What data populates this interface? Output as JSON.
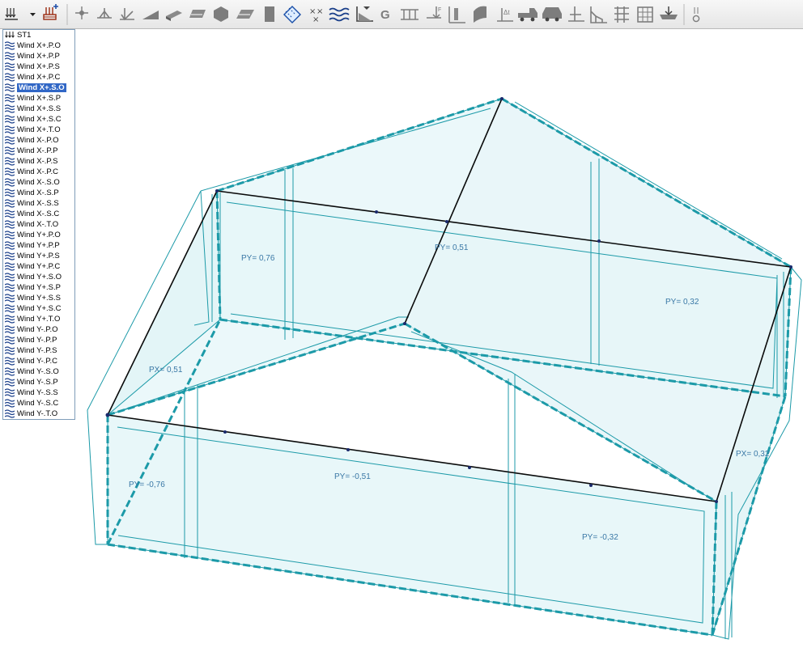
{
  "app": {
    "colors": {
      "panel_fill": "#e8f7f9",
      "edge": "#1c9aa8",
      "member": "#0a0a0a",
      "label": "#3a78a6",
      "selection": "#3167c6"
    }
  },
  "toolbar": {
    "buttons": [
      {
        "name": "load-cases-icon",
        "interactable": true
      },
      {
        "name": "dropdown-arrow-icon",
        "interactable": true
      },
      {
        "name": "add-load-case-icon",
        "interactable": true
      },
      {
        "name": "nodal-load-icon",
        "interactable": true
      },
      {
        "name": "member-load-icon",
        "interactable": true
      },
      {
        "name": "support-load-icon",
        "interactable": true
      },
      {
        "name": "linear-load-icon",
        "interactable": true
      },
      {
        "name": "surface-load-icon",
        "interactable": true
      },
      {
        "name": "panel-load-icon",
        "interactable": true
      },
      {
        "name": "solid-load-icon",
        "interactable": true
      },
      {
        "name": "planar-load-icon",
        "interactable": true
      },
      {
        "name": "block-load-icon",
        "interactable": true
      },
      {
        "name": "wind-load-icon",
        "interactable": true
      },
      {
        "name": "snow-load-icon",
        "interactable": true
      },
      {
        "name": "wave-load-icon",
        "interactable": true
      },
      {
        "name": "hydrostatic-load-icon",
        "interactable": true
      },
      {
        "name": "self-weight-icon",
        "interactable": true
      },
      {
        "name": "trapezoid-load-icon",
        "interactable": true
      },
      {
        "name": "point-force-icon",
        "interactable": true
      },
      {
        "name": "thermal-load-icon",
        "interactable": true
      },
      {
        "name": "body-force-icon",
        "interactable": true
      },
      {
        "name": "temperature-load-icon",
        "interactable": true
      },
      {
        "name": "moving-load-icon",
        "interactable": true
      },
      {
        "name": "vehicle-load-icon",
        "interactable": true
      },
      {
        "name": "displacement-load-icon",
        "interactable": true
      },
      {
        "name": "frame-load-icon",
        "interactable": true
      },
      {
        "name": "mesh-load-icon",
        "interactable": true
      },
      {
        "name": "grid-load-icon",
        "interactable": true
      },
      {
        "name": "roof-load-icon",
        "interactable": true
      },
      {
        "name": "load-parameters-icon",
        "interactable": true
      }
    ],
    "self_weight_glyph": "G"
  },
  "loadcase_list": {
    "items": [
      {
        "label": "ST1",
        "selected": false,
        "icon": "static-load-icon"
      },
      {
        "label": "Wind X+.P.O",
        "selected": false,
        "icon": "wind-load-icon"
      },
      {
        "label": "Wind X+.P.P",
        "selected": false,
        "icon": "wind-load-icon"
      },
      {
        "label": "Wind X+.P.S",
        "selected": false,
        "icon": "wind-load-icon"
      },
      {
        "label": "Wind X+.P.C",
        "selected": false,
        "icon": "wind-load-icon"
      },
      {
        "label": "Wind X+.S.O",
        "selected": true,
        "icon": "wind-load-icon"
      },
      {
        "label": "Wind X+.S.P",
        "selected": false,
        "icon": "wind-load-icon"
      },
      {
        "label": "Wind X+.S.S",
        "selected": false,
        "icon": "wind-load-icon"
      },
      {
        "label": "Wind X+.S.C",
        "selected": false,
        "icon": "wind-load-icon"
      },
      {
        "label": "Wind X+.T.O",
        "selected": false,
        "icon": "wind-load-icon"
      },
      {
        "label": "Wind X-.P.O",
        "selected": false,
        "icon": "wind-load-icon"
      },
      {
        "label": "Wind X-.P.P",
        "selected": false,
        "icon": "wind-load-icon"
      },
      {
        "label": "Wind X-.P.S",
        "selected": false,
        "icon": "wind-load-icon"
      },
      {
        "label": "Wind X-.P.C",
        "selected": false,
        "icon": "wind-load-icon"
      },
      {
        "label": "Wind X-.S.O",
        "selected": false,
        "icon": "wind-load-icon"
      },
      {
        "label": "Wind X-.S.P",
        "selected": false,
        "icon": "wind-load-icon"
      },
      {
        "label": "Wind X-.S.S",
        "selected": false,
        "icon": "wind-load-icon"
      },
      {
        "label": "Wind X-.S.C",
        "selected": false,
        "icon": "wind-load-icon"
      },
      {
        "label": "Wind X-.T.O",
        "selected": false,
        "icon": "wind-load-icon"
      },
      {
        "label": "Wind Y+.P.O",
        "selected": false,
        "icon": "wind-load-icon"
      },
      {
        "label": "Wind Y+.P.P",
        "selected": false,
        "icon": "wind-load-icon"
      },
      {
        "label": "Wind Y+.P.S",
        "selected": false,
        "icon": "wind-load-icon"
      },
      {
        "label": "Wind Y+.P.C",
        "selected": false,
        "icon": "wind-load-icon"
      },
      {
        "label": "Wind Y+.S.O",
        "selected": false,
        "icon": "wind-load-icon"
      },
      {
        "label": "Wind Y+.S.P",
        "selected": false,
        "icon": "wind-load-icon"
      },
      {
        "label": "Wind Y+.S.S",
        "selected": false,
        "icon": "wind-load-icon"
      },
      {
        "label": "Wind Y+.S.C",
        "selected": false,
        "icon": "wind-load-icon"
      },
      {
        "label": "Wind Y+.T.O",
        "selected": false,
        "icon": "wind-load-icon"
      },
      {
        "label": "Wind Y-.P.O",
        "selected": false,
        "icon": "wind-load-icon"
      },
      {
        "label": "Wind Y-.P.P",
        "selected": false,
        "icon": "wind-load-icon"
      },
      {
        "label": "Wind Y-.P.S",
        "selected": false,
        "icon": "wind-load-icon"
      },
      {
        "label": "Wind Y-.P.C",
        "selected": false,
        "icon": "wind-load-icon"
      },
      {
        "label": "Wind Y-.S.O",
        "selected": false,
        "icon": "wind-load-icon"
      },
      {
        "label": "Wind Y-.S.P",
        "selected": false,
        "icon": "wind-load-icon"
      },
      {
        "label": "Wind Y-.S.S",
        "selected": false,
        "icon": "wind-load-icon"
      },
      {
        "label": "Wind Y-.S.C",
        "selected": false,
        "icon": "wind-load-icon"
      },
      {
        "label": "Wind Y-.T.O",
        "selected": false,
        "icon": "wind-load-icon"
      }
    ]
  },
  "viewport": {
    "panel_labels": {
      "roof_left": "PY= 0,76",
      "roof_ridge": "PY= 0,51",
      "roof_right": "PY= 0,32",
      "left_gable": "PX= 0,51",
      "front_left": "PY= -0,76",
      "front_middle": "PY= -0,51",
      "front_right": "PY= -0,32",
      "right_gable": "PX= 0,32"
    }
  }
}
